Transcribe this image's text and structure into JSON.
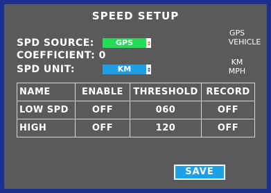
{
  "title": "SPEED  SETUP",
  "spd_source": {
    "label": "SPD SOURCE:",
    "value": "GPS",
    "options": [
      "GPS",
      "VEHICLE"
    ]
  },
  "coefficient": {
    "label": "COEFFICIENT: 0"
  },
  "spd_unit": {
    "label": "SPD UNIT:",
    "value": "KM",
    "options": [
      "KM",
      "MPH"
    ]
  },
  "table": {
    "headers": [
      "NAME",
      "ENABLE",
      "THRESHOLD",
      "RECORD"
    ],
    "rows": [
      [
        "LOW SPD",
        "OFF",
        "060",
        "OFF"
      ],
      [
        "HIGH",
        "OFF",
        "120",
        "OFF"
      ]
    ]
  },
  "save_label": "SAVE",
  "colors": {
    "background": "#5a5a5a",
    "source_select": "#22dd55",
    "unit_select": "#1ea0e8",
    "save_button": "#1ea0e8"
  }
}
